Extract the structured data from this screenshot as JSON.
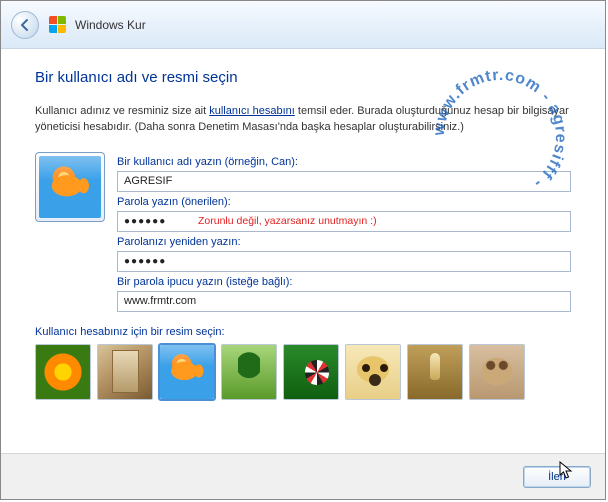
{
  "header": {
    "title": "Windows Kur"
  },
  "page": {
    "heading": "Bir kullanıcı adı ve resmi seçin",
    "desc_pre": "Kullanıcı adınız ve resminiz size ait ",
    "desc_link": "kullanıcı hesabını",
    "desc_post": " temsil eder. Burada oluşturduğunuz hesap bir bilgisayar yöneticisi hesabıdır. (Daha sonra Denetim Masası'nda başka hesaplar oluşturabilirsiniz.)"
  },
  "form": {
    "username_label": "Bir kullanıcı adı yazın (örneğin, Can):",
    "username_value": "AGRESIF",
    "password_label": "Parola yazın (önerilen):",
    "password_mask": "●●●●●●",
    "password_hint": "Zorunlu değil, yazarsanız unutmayın :)",
    "password2_label": "Parolanızı yeniden yazın:",
    "password2_mask": "●●●●●●",
    "hint_label": "Bir parola ipucu yazın (isteğe bağlı):",
    "hint_value": "www.frmtr.com"
  },
  "picker": {
    "label": "Kullanıcı hesabınız için bir resim seçin:",
    "items": [
      {
        "name": "flower"
      },
      {
        "name": "blocks"
      },
      {
        "name": "goldfish",
        "selected": true
      },
      {
        "name": "bonsai"
      },
      {
        "name": "soccer-ball"
      },
      {
        "name": "puppy"
      },
      {
        "name": "chess"
      },
      {
        "name": "kitten"
      }
    ]
  },
  "footer": {
    "next": "İleri"
  },
  "watermark": "www.frmtr.com - agresifff -"
}
